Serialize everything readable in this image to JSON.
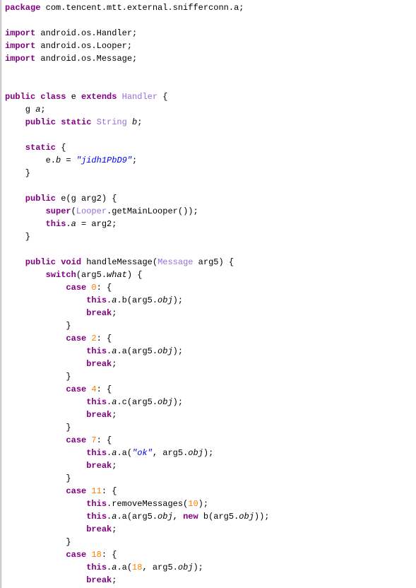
{
  "l1_kw": "package",
  "l1_pkg": " com.tencent.mtt.external.snifferconn.a;",
  "l3_kw": "import",
  "l3_t": " android.os.Handler;",
  "l4_kw": "import",
  "l4_t": " android.os.Looper;",
  "l5_kw": "import",
  "l5_t": " android.os.Message;",
  "l8_kw1": "public class",
  "l8_n": " e ",
  "l8_kw2": "extends",
  "l8_type": " Handler",
  "l8_t": " {",
  "l9_t1": "    g ",
  "l9_a": "a",
  "l9_t2": ";",
  "l10_kw": "    public static",
  "l10_type": " String",
  "l10_b": " b",
  "l10_t": ";",
  "l12_kw": "    static",
  "l12_t": " {",
  "l13_t1": "        e.",
  "l13_b": "b",
  "l13_t2": " = ",
  "l13_str": "\"jidh1PbD9\"",
  "l13_t3": ";",
  "l14_t": "    }",
  "l16_kw": "    public",
  "l16_t1": " e(g arg2) {",
  "l17_kw": "        super",
  "l17_t1": "(",
  "l17_type": "Looper",
  "l17_t2": ".getMainLooper());",
  "l18_kw": "        this",
  "l18_t1": ".",
  "l18_a": "a",
  "l18_t2": " = arg2;",
  "l19_t": "    }",
  "l21_kw": "    public void",
  "l21_t1": " handleMessage(",
  "l21_type": "Message",
  "l21_t2": " arg5) {",
  "l22_kw": "        switch",
  "l22_t1": "(arg5.",
  "l22_w": "what",
  "l22_t2": ") {",
  "l23_kw": "            case",
  "l23_n": " 0",
  "l23_t": ": {",
  "l24_kw": "                this",
  "l24_t1": ".",
  "l24_a": "a",
  "l24_t2": ".b(arg5.",
  "l24_o": "obj",
  "l24_t3": ");",
  "l25_kw": "                break",
  "l25_t": ";",
  "l26_t": "            }",
  "l27_kw": "            case",
  "l27_n": " 2",
  "l27_t": ": {",
  "l28_kw": "                this",
  "l28_t1": ".",
  "l28_a": "a",
  "l28_t2": ".a(arg5.",
  "l28_o": "obj",
  "l28_t3": ");",
  "l29_kw": "                break",
  "l29_t": ";",
  "l30_t": "            }",
  "l31_kw": "            case",
  "l31_n": " 4",
  "l31_t": ": {",
  "l32_kw": "                this",
  "l32_t1": ".",
  "l32_a": "a",
  "l32_t2": ".c(arg5.",
  "l32_o": "obj",
  "l32_t3": ");",
  "l33_kw": "                break",
  "l33_t": ";",
  "l34_t": "            }",
  "l35_kw": "            case",
  "l35_n": " 7",
  "l35_t": ": {",
  "l36_kw": "                this",
  "l36_t1": ".",
  "l36_a": "a",
  "l36_t2": ".a(",
  "l36_str": "\"ok\"",
  "l36_t3": ", arg5.",
  "l36_o": "obj",
  "l36_t4": ");",
  "l37_kw": "                break",
  "l37_t": ";",
  "l38_t": "            }",
  "l39_kw": "            case",
  "l39_n": " 11",
  "l39_t": ": {",
  "l40_kw": "                this",
  "l40_t1": ".removeMessages(",
  "l40_n": "10",
  "l40_t2": ");",
  "l41_kw": "                this",
  "l41_t1": ".",
  "l41_a": "a",
  "l41_t2": ".a(arg5.",
  "l41_o": "obj",
  "l41_t3": ", ",
  "l41_kw2": "new",
  "l41_t4": " b(arg5.",
  "l41_o2": "obj",
  "l41_t5": "));",
  "l42_kw": "                break",
  "l42_t": ";",
  "l43_t": "            }",
  "l44_kw": "            case",
  "l44_n": " 18",
  "l44_t": ": {",
  "l45_kw": "                this",
  "l45_t1": ".",
  "l45_a": "a",
  "l45_t2": ".a(",
  "l45_n": "18",
  "l45_t3": ", arg5.",
  "l45_o": "obj",
  "l45_t4": ");",
  "l46_kw": "                break",
  "l46_t": ";"
}
